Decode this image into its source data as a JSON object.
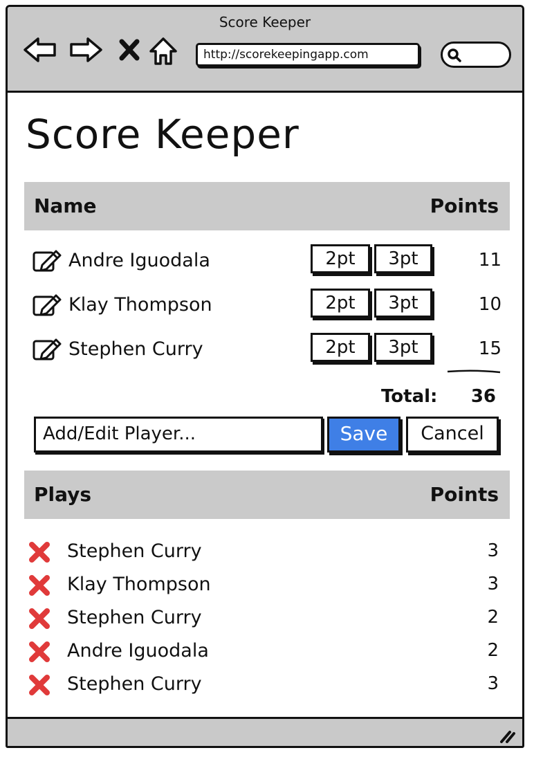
{
  "window": {
    "title": "Score Keeper"
  },
  "browser": {
    "url": "http://scorekeepingapp.com",
    "nav_icons": [
      "back-arrow-icon",
      "forward-arrow-icon",
      "stop-icon",
      "home-icon"
    ],
    "search_icon": "search-icon"
  },
  "page": {
    "title": "Score Keeper"
  },
  "players_table": {
    "header_name": "Name",
    "header_points": "Points",
    "rows": [
      {
        "name": "Andre Iguodala",
        "btn2": "2pt",
        "btn3": "3pt",
        "points": "11"
      },
      {
        "name": "Klay Thompson",
        "btn2": "2pt",
        "btn3": "3pt",
        "points": "10"
      },
      {
        "name": "Stephen Curry",
        "btn2": "2pt",
        "btn3": "3pt",
        "points": "15"
      }
    ],
    "total_label": "Total:",
    "total_value": "36"
  },
  "editor": {
    "input_placeholder": "Add/Edit Player...",
    "save_label": "Save",
    "cancel_label": "Cancel"
  },
  "plays_table": {
    "header_plays": "Plays",
    "header_points": "Points",
    "rows": [
      {
        "name": "Stephen Curry",
        "points": "3"
      },
      {
        "name": "Klay Thompson",
        "points": "3"
      },
      {
        "name": "Stephen Curry",
        "points": "2"
      },
      {
        "name": "Andre Iguodala",
        "points": "2"
      },
      {
        "name": "Stephen Curry",
        "points": "3"
      }
    ]
  },
  "colors": {
    "accent": "#3f7fe6",
    "header_bg": "#cacaca",
    "delete": "#e03a3a"
  }
}
